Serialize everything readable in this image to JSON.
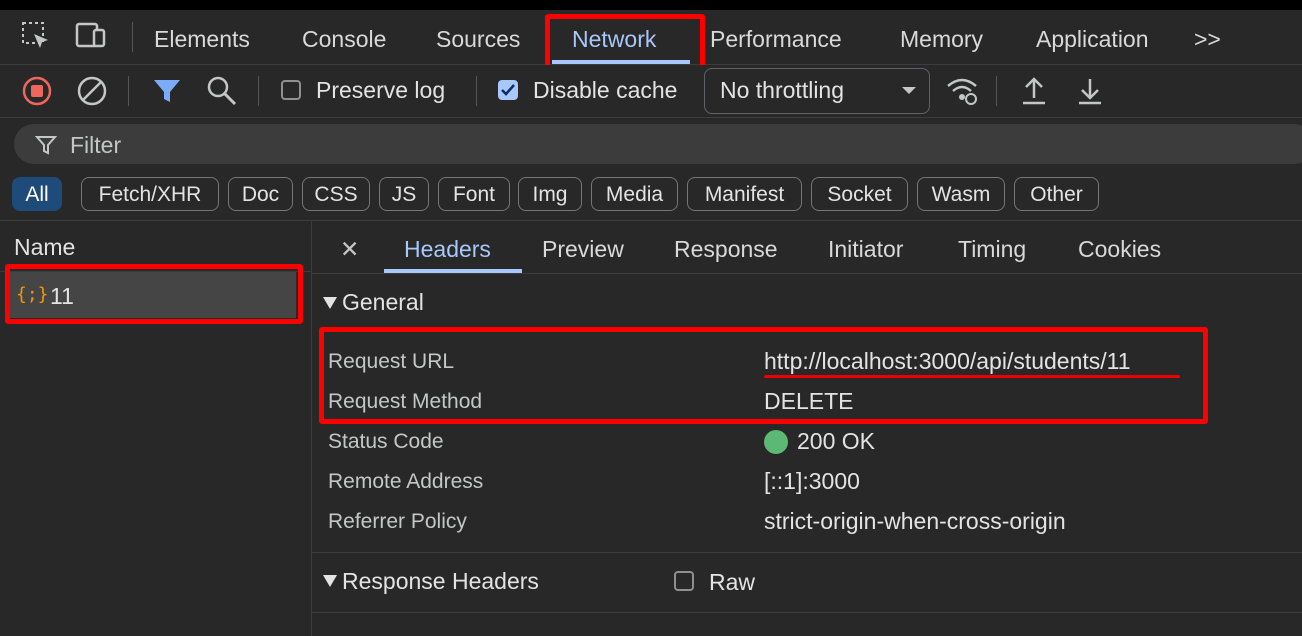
{
  "toolbar": {
    "tabs": [
      {
        "label": "Elements"
      },
      {
        "label": "Console"
      },
      {
        "label": "Sources"
      },
      {
        "label": "Network"
      },
      {
        "label": "Performance"
      },
      {
        "label": "Memory"
      },
      {
        "label": "Application"
      }
    ],
    "more_icon": ">>",
    "active_tab": "Network"
  },
  "network_controls": {
    "preserve_log": "Preserve log",
    "preserve_log_checked": false,
    "disable_cache": "Disable cache",
    "disable_cache_checked": true,
    "throttling": "No throttling"
  },
  "filter": {
    "placeholder": "Filter"
  },
  "type_filters": [
    {
      "label": "All"
    },
    {
      "label": "Fetch/XHR"
    },
    {
      "label": "Doc"
    },
    {
      "label": "CSS"
    },
    {
      "label": "JS"
    },
    {
      "label": "Font"
    },
    {
      "label": "Img"
    },
    {
      "label": "Media"
    },
    {
      "label": "Manifest"
    },
    {
      "label": "Socket"
    },
    {
      "label": "Wasm"
    },
    {
      "label": "Other"
    }
  ],
  "request_list": {
    "header": "Name",
    "rows": [
      {
        "icon": "{;}",
        "name": "11"
      }
    ]
  },
  "details": {
    "close": "✕",
    "tabs": [
      {
        "label": "Headers"
      },
      {
        "label": "Preview"
      },
      {
        "label": "Response"
      },
      {
        "label": "Initiator"
      },
      {
        "label": "Timing"
      },
      {
        "label": "Cookies"
      }
    ],
    "general": {
      "title": "General",
      "rows": [
        {
          "key": "Request URL",
          "value": "http://localhost:3000/api/students/11"
        },
        {
          "key": "Request Method",
          "value": "DELETE"
        },
        {
          "key": "Status Code",
          "value": "200 OK"
        },
        {
          "key": "Remote Address",
          "value": "[::1]:3000"
        },
        {
          "key": "Referrer Policy",
          "value": "strict-origin-when-cross-origin"
        }
      ]
    },
    "response_headers": {
      "title": "Response Headers",
      "raw_label": "Raw",
      "raw_checked": false
    }
  },
  "colors": {
    "accent": "#a8c7fa",
    "highlight": "#ff0000",
    "status_ok": "#5bb974"
  }
}
